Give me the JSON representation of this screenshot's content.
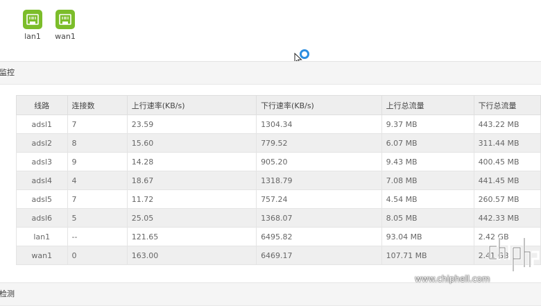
{
  "ports": [
    {
      "label": "lan1",
      "icon": "ethernet-port-icon",
      "color": "#7cbd2a"
    },
    {
      "label": "wan1",
      "icon": "ethernet-port-icon",
      "color": "#7cbd2a"
    }
  ],
  "monitor_section": {
    "title": "监控"
  },
  "detect_section": {
    "title": "检测"
  },
  "table": {
    "headers": [
      "线路",
      "连接数",
      "上行速率(KB/s)",
      "下行速率(KB/s)",
      "上行总流量",
      "下行总流量"
    ],
    "rows": [
      [
        "adsl1",
        "7",
        "23.59",
        "1304.34",
        "9.37 MB",
        "443.22 MB"
      ],
      [
        "adsl2",
        "8",
        "15.60",
        "779.52",
        "6.07 MB",
        "311.44 MB"
      ],
      [
        "adsl3",
        "9",
        "14.28",
        "905.20",
        "9.43 MB",
        "400.45 MB"
      ],
      [
        "adsl4",
        "4",
        "18.67",
        "1318.79",
        "7.08 MB",
        "441.45 MB"
      ],
      [
        "adsl5",
        "7",
        "11.72",
        "757.24",
        "4.54 MB",
        "260.57 MB"
      ],
      [
        "adsl6",
        "5",
        "25.05",
        "1368.07",
        "8.05 MB",
        "442.33 MB"
      ],
      [
        "lan1",
        "--",
        "121.65",
        "6495.82",
        "93.04 MB",
        "2.42 GB"
      ],
      [
        "wan1",
        "0",
        "163.00",
        "6469.17",
        "107.71 MB",
        "2.41 GB"
      ]
    ]
  },
  "watermark": {
    "text": "www.chiphell.com"
  },
  "colors": {
    "port_green": "#7cbd2a",
    "busy_blue": "#2d8ee0"
  }
}
